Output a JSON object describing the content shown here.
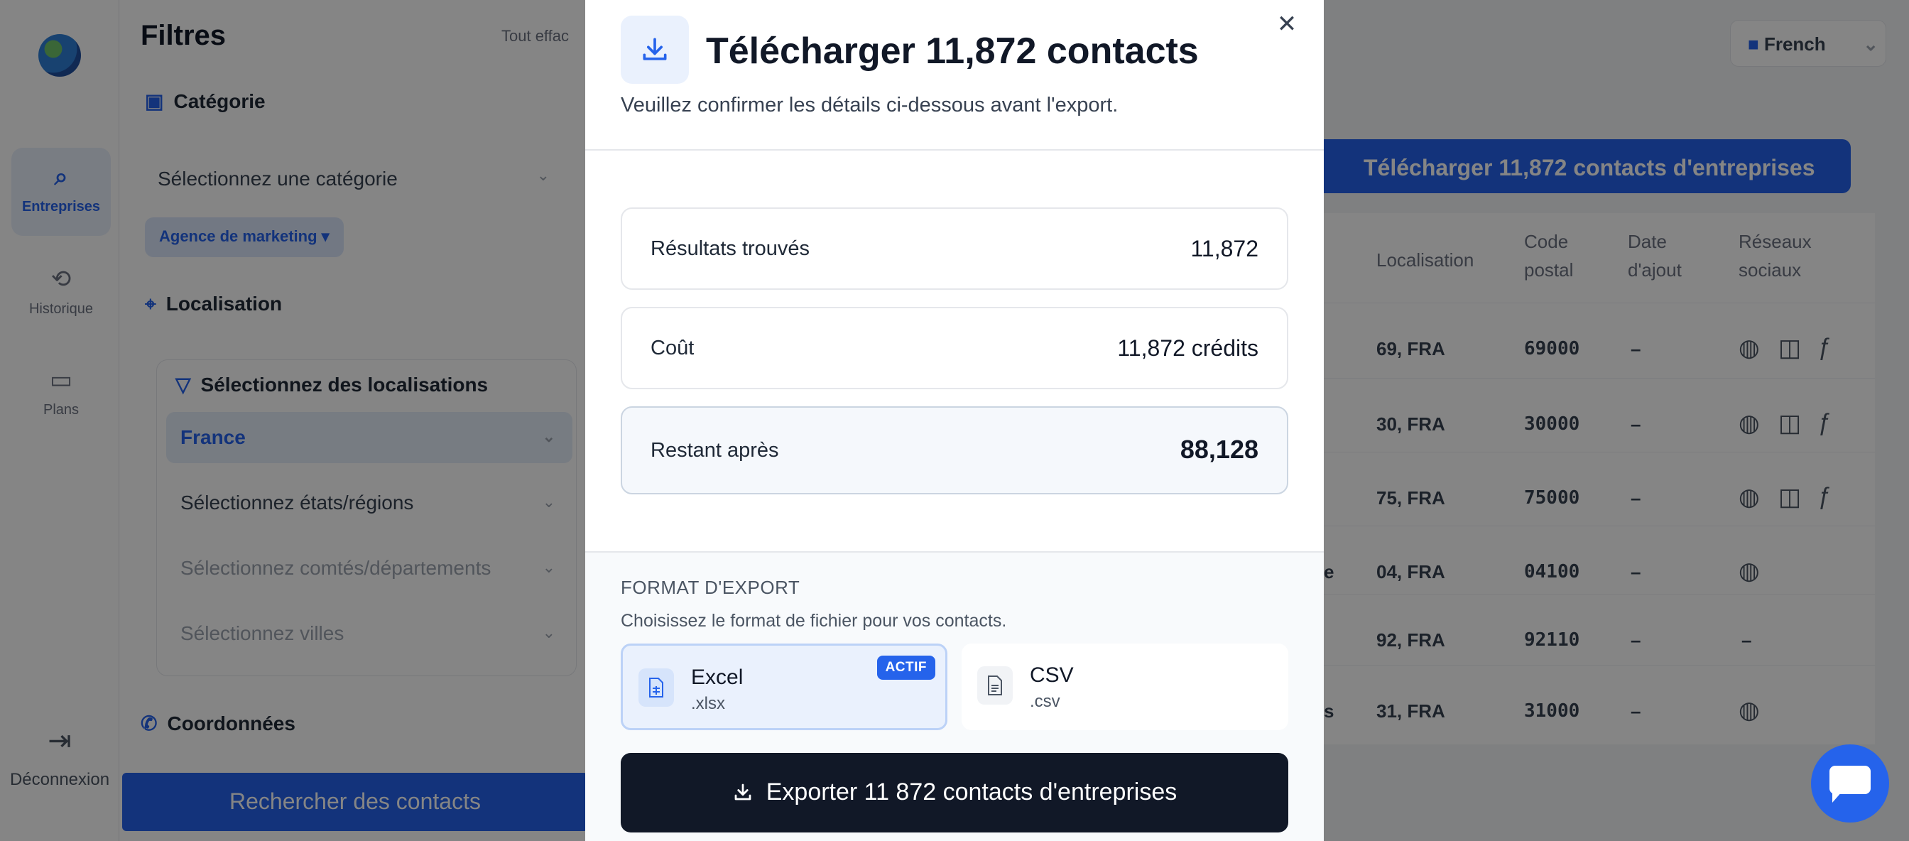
{
  "nav": {
    "items": [
      {
        "label": "Entreprises",
        "icon": "search-icon"
      },
      {
        "label": "Historique",
        "icon": "history-icon"
      },
      {
        "label": "Plans",
        "icon": "card-icon"
      }
    ],
    "logout": "Déconnexion"
  },
  "filters": {
    "title": "Filtres",
    "clear": "Tout effac",
    "category": {
      "title": "Catégorie",
      "placeholder": "Sélectionnez une catégorie",
      "chip": "Agence de marketing"
    },
    "location": {
      "title": "Localisation",
      "sub_title": "Sélectionnez des localisations",
      "country": "France",
      "regions": "Sélectionnez états/régions",
      "departments": "Sélectionnez comtés/départements",
      "cities": "Sélectionnez villes"
    },
    "contact": {
      "title": "Coordonnées"
    },
    "search_button": "Rechercher des contacts"
  },
  "header": {
    "language": "French"
  },
  "results": {
    "download_banner": "Télécharger 11,872 contacts d'entreprises",
    "columns": [
      "Localisation",
      "Code postal",
      "Date d'ajout",
      "Réseaux sociaux"
    ],
    "rows": [
      {
        "prefix": "",
        "loc": "69, FRA",
        "zip": "69000",
        "date": "–"
      },
      {
        "prefix": "",
        "loc": "30, FRA",
        "zip": "30000",
        "date": "–"
      },
      {
        "prefix": "",
        "loc": "75, FRA",
        "zip": "75000",
        "date": "–"
      },
      {
        "prefix": "e",
        "loc": "04, FRA",
        "zip": "04100",
        "date": "–"
      },
      {
        "prefix": "",
        "loc": "92, FRA",
        "zip": "92110",
        "date": "–"
      },
      {
        "prefix": "s",
        "loc": "31, FRA",
        "zip": "31000",
        "date": "–"
      }
    ]
  },
  "modal": {
    "title": "Télécharger 11,872 contacts",
    "subtitle": "Veuillez confirmer les détails ci-dessous avant l'export.",
    "stats": [
      {
        "label": "Résultats trouvés",
        "value": "11,872"
      },
      {
        "label": "Coût",
        "value": "11,872 crédits"
      },
      {
        "label": "Restant après",
        "value": "88,128"
      }
    ],
    "format": {
      "title": "FORMAT D'EXPORT",
      "subtitle": "Choisissez le format de fichier pour vos contacts.",
      "options": [
        {
          "name": "Excel",
          "ext": ".xlsx",
          "badge": "ACTIF",
          "active": true
        },
        {
          "name": "CSV",
          "ext": ".csv",
          "active": false
        }
      ]
    },
    "export_button": "Exporter 11 872 contacts d'entreprises"
  },
  "colors": {
    "accent": "#2563eb",
    "dark": "#111827",
    "overlay": "rgba(0,0,0,0.48)"
  }
}
